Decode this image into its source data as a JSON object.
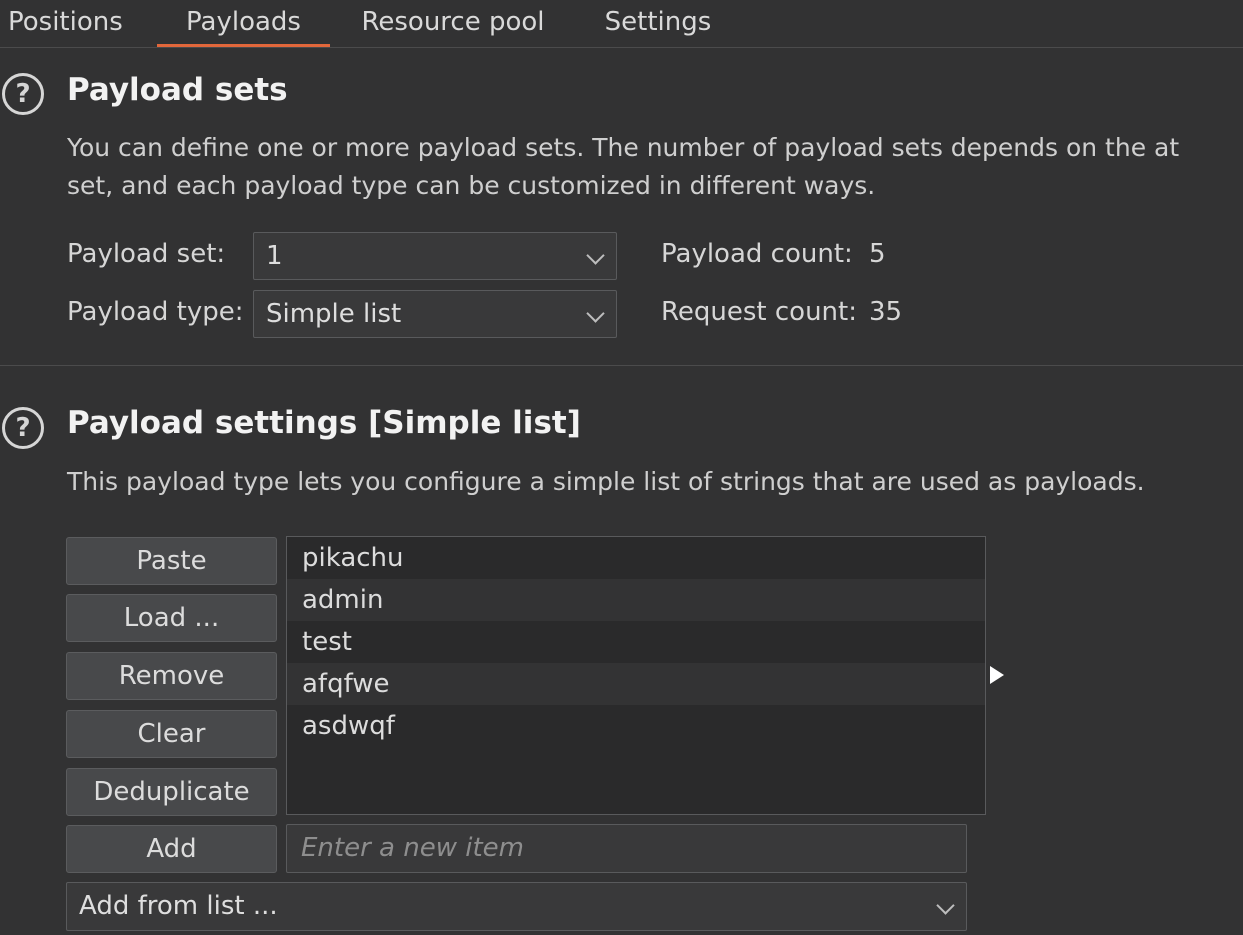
{
  "tabs": [
    {
      "label": "Positions"
    },
    {
      "label": "Payloads"
    },
    {
      "label": "Resource pool"
    },
    {
      "label": "Settings"
    }
  ],
  "payload_sets": {
    "title": "Payload sets",
    "desc_line1": "You can define one or more payload sets. The number of payload sets depends on the at",
    "desc_line2": "set, and each payload type can be customized in different ways.",
    "set_label": "Payload set:",
    "set_value": "1",
    "type_label": "Payload type:",
    "type_value": "Simple list",
    "payload_count_label": "Payload count:",
    "payload_count_value": "5",
    "request_count_label": "Request count:",
    "request_count_value": "35"
  },
  "payload_settings": {
    "title": "Payload settings [Simple list]",
    "desc": "This payload type lets you configure a simple list of strings that are used as payloads.",
    "buttons": {
      "paste": "Paste",
      "load": "Load ...",
      "remove": "Remove",
      "clear": "Clear",
      "deduplicate": "Deduplicate",
      "add": "Add"
    },
    "items": [
      "pikachu",
      "admin",
      "test",
      "afqfwe",
      "asdwqf"
    ],
    "new_item_placeholder": "Enter a new item",
    "add_from_list": "Add from list ..."
  },
  "icons": {
    "help": "help-circle-icon",
    "chevron": "chevron-down-icon",
    "cursor": "mouse-pointer-icon"
  },
  "colors": {
    "accent": "#e2673b",
    "background": "#323233"
  }
}
